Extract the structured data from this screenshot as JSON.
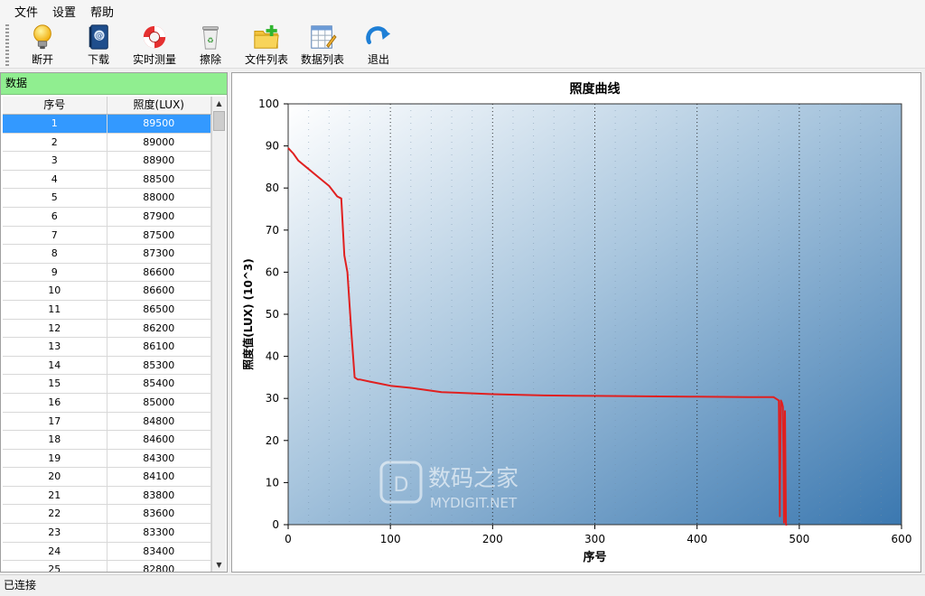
{
  "menu": [
    "文件",
    "设置",
    "帮助"
  ],
  "toolbar": [
    {
      "label": "断开",
      "icon": "lightbulb-icon"
    },
    {
      "label": "下载",
      "icon": "address-book-icon"
    },
    {
      "label": "实时测量",
      "icon": "lifebuoy-icon"
    },
    {
      "label": "擦除",
      "icon": "recycle-bin-icon"
    },
    {
      "label": "文件列表",
      "icon": "folder-add-icon"
    },
    {
      "label": "数据列表",
      "icon": "table-edit-icon"
    },
    {
      "label": "退出",
      "icon": "redo-arrow-icon"
    }
  ],
  "panel": {
    "title": "数据",
    "columns": [
      "序号",
      "照度(LUX)"
    ],
    "rows": [
      [
        "1",
        "89500"
      ],
      [
        "2",
        "89000"
      ],
      [
        "3",
        "88900"
      ],
      [
        "4",
        "88500"
      ],
      [
        "5",
        "88000"
      ],
      [
        "6",
        "87900"
      ],
      [
        "7",
        "87500"
      ],
      [
        "8",
        "87300"
      ],
      [
        "9",
        "86600"
      ],
      [
        "10",
        "86600"
      ],
      [
        "11",
        "86500"
      ],
      [
        "12",
        "86200"
      ],
      [
        "13",
        "86100"
      ],
      [
        "14",
        "85300"
      ],
      [
        "15",
        "85400"
      ],
      [
        "16",
        "85000"
      ],
      [
        "17",
        "84800"
      ],
      [
        "18",
        "84600"
      ],
      [
        "19",
        "84300"
      ],
      [
        "20",
        "84100"
      ],
      [
        "21",
        "83800"
      ],
      [
        "22",
        "83600"
      ],
      [
        "23",
        "83300"
      ],
      [
        "24",
        "83400"
      ],
      [
        "25",
        "82800"
      ]
    ],
    "selected_row": 0
  },
  "chart_data": {
    "type": "line",
    "title": "照度曲线",
    "xlabel": "序号",
    "ylabel": "照度值(LUX) (10^3)",
    "xlim": [
      0,
      600
    ],
    "ylim": [
      0,
      100
    ],
    "xticks": [
      0,
      100,
      200,
      300,
      400,
      500,
      600
    ],
    "yticks": [
      0,
      10,
      20,
      30,
      40,
      50,
      60,
      70,
      80,
      90,
      100
    ],
    "grid": "dotted-vertical",
    "series": [
      {
        "color": "#e02020",
        "x": [
          0,
          5,
          10,
          20,
          30,
          40,
          48,
          52,
          55,
          58,
          62,
          65,
          68,
          70,
          80,
          90,
          100,
          120,
          150,
          200,
          250,
          300,
          350,
          400,
          450,
          475,
          480,
          481,
          482,
          483,
          484,
          485,
          486,
          487,
          488
        ],
        "y": [
          89.5,
          88.2,
          86.5,
          84.5,
          82.5,
          80.5,
          78,
          77.5,
          64,
          60,
          45,
          35,
          34.5,
          34.5,
          34,
          33.5,
          33,
          32.5,
          31.5,
          31,
          30.7,
          30.6,
          30.5,
          30.4,
          30.3,
          30.3,
          29.5,
          2,
          29.5,
          29,
          28,
          0.5,
          27,
          0,
          0
        ]
      }
    ]
  },
  "watermark": {
    "line1": "数码之家",
    "line2": "MYDIGIT.NET"
  },
  "status": "已连接",
  "colors": {
    "header_green": "#90ee90",
    "selection": "#3399ff",
    "series": "#e02020",
    "plot_dark": "#3b78b0"
  }
}
